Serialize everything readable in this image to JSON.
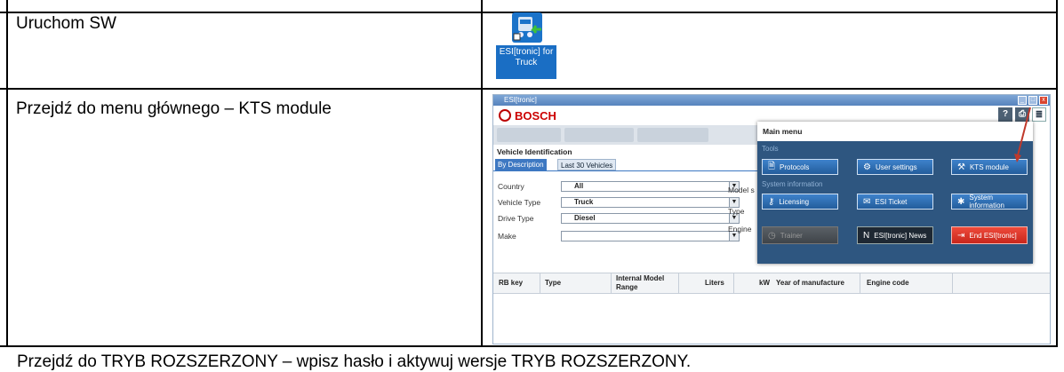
{
  "steps": [
    {
      "text": "Uruchom SW"
    },
    {
      "text": "Przejdź do menu głównego – KTS module"
    },
    {
      "text": "Przejdź do TRYB ROZSZERZONY – wpisz hasło i aktywuj wersje TRYB ROZSZERZONY."
    }
  ],
  "desktop_icon": {
    "caption": "ESI[tronic] for Truck",
    "icon": "truck-esi-icon"
  },
  "screenshot": {
    "window_title": "ESI[tronic]",
    "brand": "BOSCH",
    "section_title": "Vehicle Identification",
    "tabs": [
      "By Description",
      "Last 30 Vehicles"
    ],
    "fields": [
      {
        "label": "Country",
        "value": "All"
      },
      {
        "label": "Vehicle Type",
        "value": "Truck"
      },
      {
        "label": "Drive Type",
        "value": "Diesel"
      },
      {
        "label": "Make",
        "value": ""
      }
    ],
    "partial_labels": [
      "Model s",
      "Type",
      "Engine"
    ],
    "grid_columns": [
      "RB key",
      "Type",
      "Internal Model Range",
      "Liters",
      "kW",
      "Year of manufacture",
      "Engine code"
    ],
    "main_menu": {
      "title": "Main menu",
      "sections": [
        "Tools",
        "System information"
      ],
      "buttons": [
        {
          "label": "Protocols",
          "icon": "protocols-icon"
        },
        {
          "label": "User settings",
          "icon": "gear-icon"
        },
        {
          "label": "KTS module",
          "icon": "kts-icon"
        },
        {
          "label": "Licensing",
          "icon": "key-icon"
        },
        {
          "label": "ESI Ticket",
          "icon": "ticket-icon"
        },
        {
          "label": "System information",
          "icon": "stars-icon"
        },
        {
          "label": "Trainer",
          "icon": "trainer-icon"
        },
        {
          "label": "ESI[tronic] News",
          "icon": "news-icon"
        },
        {
          "label": "End ESI[tronic]",
          "icon": "exit-icon"
        }
      ]
    },
    "colors": {
      "accent": "#3d78c2",
      "menu_bg": "#2e5680",
      "brand": "#cc0000",
      "end_button": "#e23a2c",
      "arrow": "#c0392b"
    }
  }
}
